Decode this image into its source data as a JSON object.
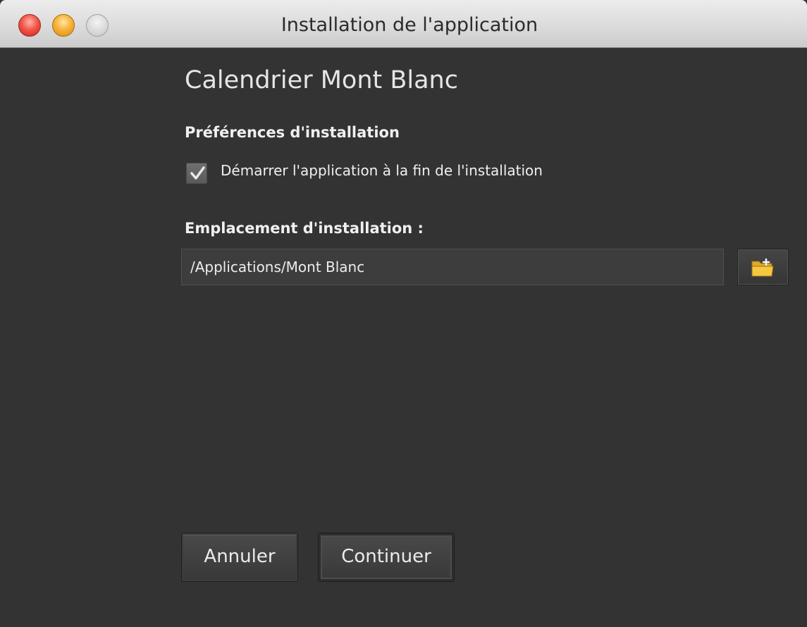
{
  "window": {
    "title": "Installation de l'application"
  },
  "app": {
    "name": "Calendrier Mont Blanc"
  },
  "preferences": {
    "heading": "Préférences d'installation",
    "launch_after_install_label": "Démarrer l'application à la fin de l'installation",
    "launch_after_install_checked": true
  },
  "location": {
    "heading": "Emplacement d'installation :",
    "path": "/Applications/Mont Blanc"
  },
  "buttons": {
    "cancel": "Annuler",
    "continue": "Continuer"
  },
  "icons": {
    "close": "close-icon",
    "minimize": "minimize-icon",
    "zoom": "zoom-icon",
    "browse": "folder-icon",
    "check": "checkmark-icon"
  },
  "colors": {
    "background": "#333333",
    "titlebar": "#dcdcdc",
    "text": "#f0f0f0",
    "close": "#f2574a",
    "minimize": "#f7b33b",
    "folder": "#f5c842"
  }
}
